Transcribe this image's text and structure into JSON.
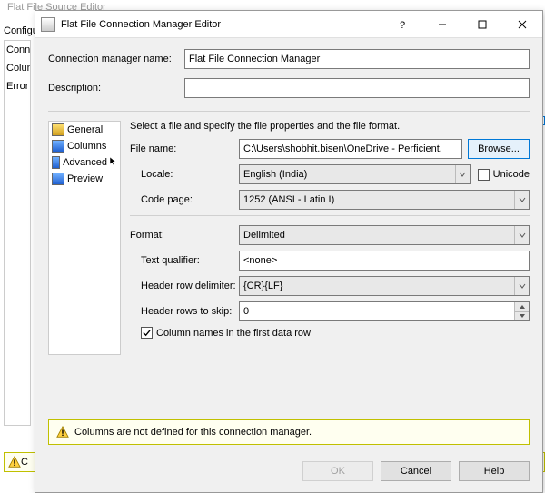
{
  "background": {
    "window_title": "Flat File Source Editor",
    "instruction": "Configure the properties used to connect to and obtain data from a text file.",
    "sidebar": [
      "Conne",
      "Colum",
      "Error C"
    ],
    "warning_prefix": "C"
  },
  "dialog": {
    "title": "Flat File Connection Manager Editor",
    "conn_name_label": "Connection manager name:",
    "conn_name_value": "Flat File Connection Manager",
    "desc_label": "Description:",
    "desc_value": "",
    "nav": {
      "general": "General",
      "columns": "Columns",
      "advanced": "Advanced",
      "preview": "Preview"
    },
    "instruction": "Select a file and specify the file properties and the file format.",
    "filename_label": "File name:",
    "filename_value": "C:\\Users\\shobhit.bisen\\OneDrive - Perficient,",
    "browse": "Browse...",
    "locale_label": "Locale:",
    "locale_value": "English (India)",
    "unicode_label": "Unicode",
    "unicode_checked": false,
    "codepage_label": "Code page:",
    "codepage_value": "1252  (ANSI - Latin I)",
    "format_label": "Format:",
    "format_value": "Delimited",
    "textq_label": "Text qualifier:",
    "textq_value": "<none>",
    "hrd_label": "Header row delimiter:",
    "hrd_value": "{CR}{LF}",
    "hskip_label": "Header rows to skip:",
    "hskip_value": "0",
    "colnames_label": "Column names in the first data row",
    "colnames_checked": true,
    "warning": "Columns are not defined for this connection manager.",
    "buttons": {
      "ok": "OK",
      "cancel": "Cancel",
      "help": "Help"
    }
  }
}
